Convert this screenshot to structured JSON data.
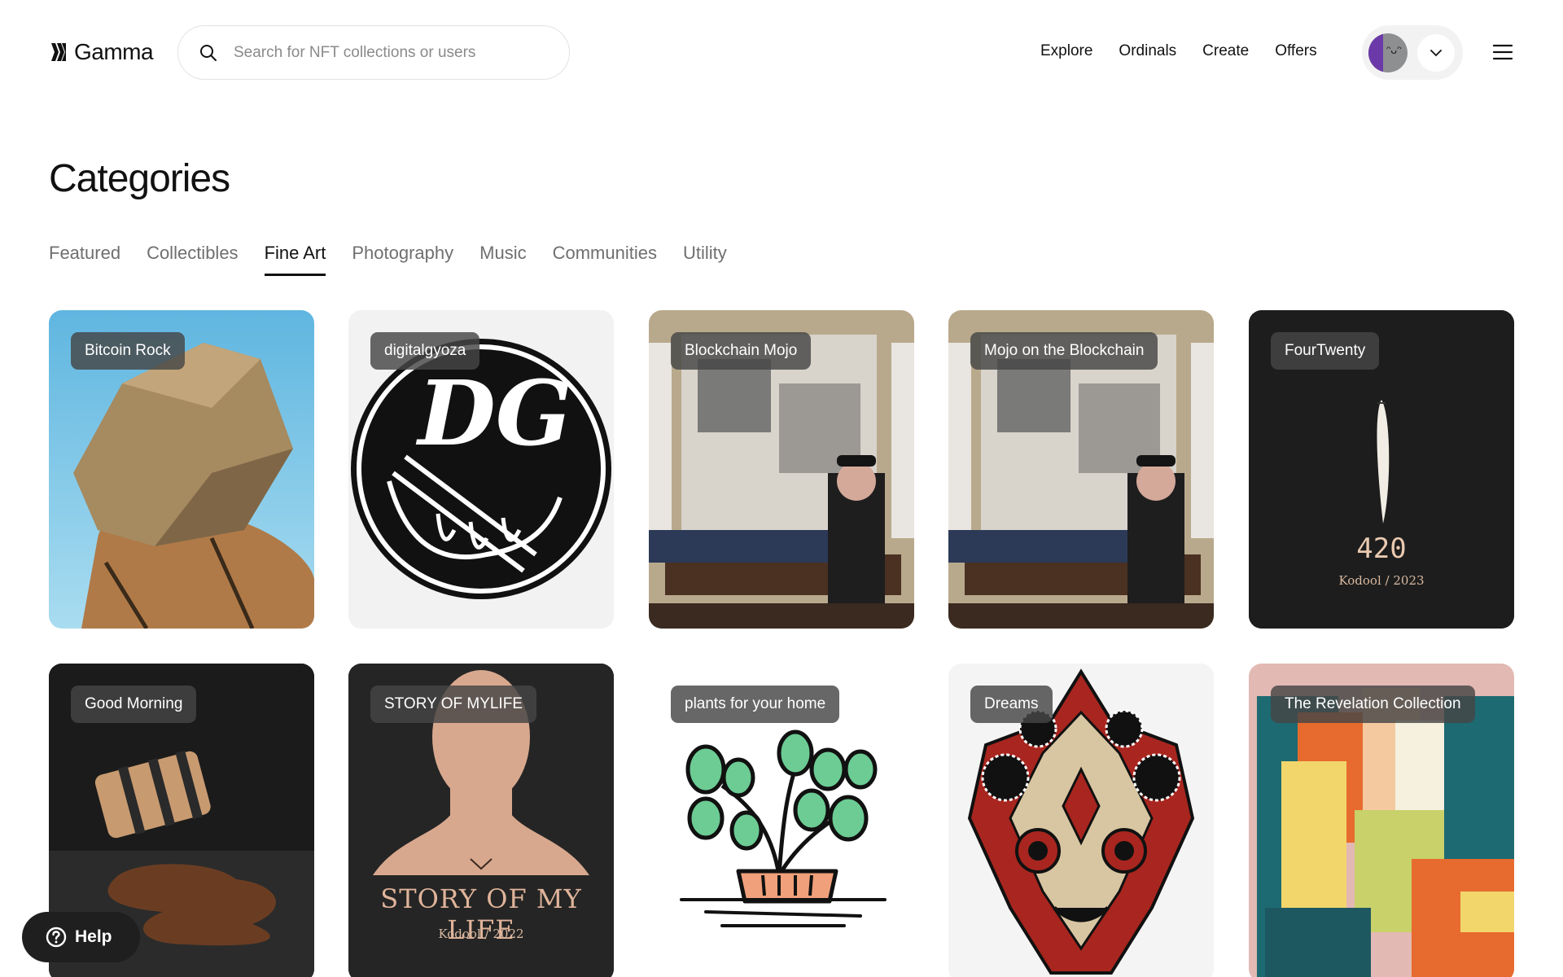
{
  "header": {
    "logo_text": "Gamma",
    "search": {
      "placeholder": "Search for NFT collections or users"
    },
    "nav": [
      "Explore",
      "Ordinals",
      "Create",
      "Offers"
    ]
  },
  "page": {
    "title": "Categories",
    "tabs": [
      "Featured",
      "Collectibles",
      "Fine Art",
      "Photography",
      "Music",
      "Communities",
      "Utility"
    ],
    "active_tab": "Fine Art"
  },
  "collections": [
    {
      "name": "Bitcoin Rock"
    },
    {
      "name": "digitalgyoza"
    },
    {
      "name": "Blockchain Mojo"
    },
    {
      "name": "Mojo on the Blockchain"
    },
    {
      "name": "FourTwenty",
      "art_text": "420",
      "art_caption": "Kodool / 2023"
    },
    {
      "name": "Good Morning"
    },
    {
      "name": "STORY OF MYLIFE",
      "art_text": "STORY OF MY LIFE",
      "art_caption": "Kodool / 2022"
    },
    {
      "name": "plants for your home"
    },
    {
      "name": "Dreams"
    },
    {
      "name": "The Revelation Collection"
    }
  ],
  "help": {
    "label": "Help"
  },
  "colors": {
    "accent": "#111111",
    "label_bg": "#464646",
    "search_border": "#e3e3e3"
  }
}
